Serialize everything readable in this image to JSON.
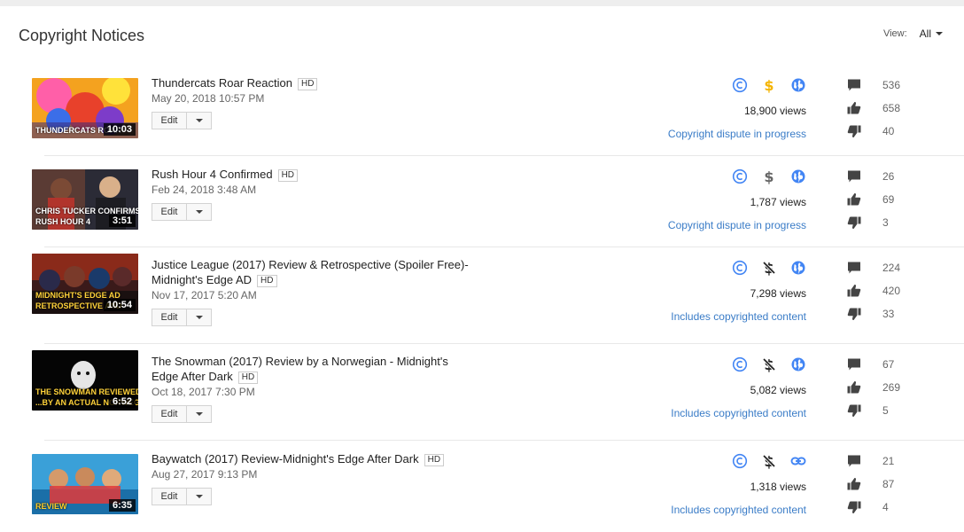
{
  "header": {
    "title": "Copyright Notices",
    "view_label": "View:",
    "view_value": "All"
  },
  "icons": {
    "copyright": "copyright-icon",
    "monetized": "dollar-icon",
    "demonetized": "dollar-off-icon",
    "public": "globe-icon",
    "unlisted": "link-icon",
    "comments": "comment-icon",
    "likes": "thumbs-up-icon",
    "dislikes": "thumbs-down-icon"
  },
  "colors": {
    "accent_blue": "#4285f4",
    "monetized_gold": "#f4b400",
    "link_blue": "#3a7cc7"
  },
  "edit_label": "Edit",
  "videos": [
    {
      "title_line1": "Thundercats Roar Reaction",
      "title_line2": "",
      "hd": "HD",
      "date": "May 20, 2018 10:57 PM",
      "duration": "10:03",
      "thumb_caption1": "",
      "thumb_caption2": "THUNDERCATS ROAR",
      "monetization": "monetized",
      "visibility": "public",
      "views": "18,900 views",
      "notice": "Copyright dispute in progress",
      "comments": "536",
      "likes": "658",
      "dislikes": "40"
    },
    {
      "title_line1": "Rush Hour 4 Confirmed",
      "title_line2": "",
      "hd": "HD",
      "date": "Feb 24, 2018 3:48 AM",
      "duration": "3:51",
      "thumb_caption1": "CHRIS TUCKER CONFIRMS",
      "thumb_caption2": "RUSH HOUR 4",
      "monetization": "monetized-gray",
      "visibility": "public",
      "views": "1,787 views",
      "notice": "Copyright dispute in progress",
      "comments": "26",
      "likes": "69",
      "dislikes": "3"
    },
    {
      "title_line1": "Justice League (2017) Review & Retrospective (Spoiler Free)-",
      "title_line2": "Midnight's Edge AD",
      "hd": "HD",
      "date": "Nov 17, 2017 5:20 AM",
      "duration": "10:54",
      "thumb_caption1": "MIDNIGHT'S EDGE AD",
      "thumb_caption2": "RETROSPECTIVE AND",
      "monetization": "demonetized",
      "visibility": "public",
      "views": "7,298 views",
      "notice": "Includes copyrighted content",
      "comments": "224",
      "likes": "420",
      "dislikes": "33"
    },
    {
      "title_line1": "The Snowman (2017) Review by a Norwegian - Midnight's",
      "title_line2": "Edge After Dark",
      "hd": "HD",
      "date": "Oct 18, 2017 7:30 PM",
      "duration": "6:52",
      "thumb_caption1": "THE SNOWMAN REVIEWED",
      "thumb_caption2": "...BY AN ACTUAL NORWEGIAN",
      "monetization": "demonetized",
      "visibility": "public",
      "views": "5,082 views",
      "notice": "Includes copyrighted content",
      "comments": "67",
      "likes": "269",
      "dislikes": "5"
    },
    {
      "title_line1": "Baywatch (2017) Review-Midnight's Edge After Dark",
      "title_line2": "",
      "hd": "HD",
      "date": "Aug 27, 2017 9:13 PM",
      "duration": "6:35",
      "thumb_caption1": "",
      "thumb_caption2": "REVIEW",
      "monetization": "demonetized",
      "visibility": "unlisted",
      "views": "1,318 views",
      "notice": "Includes copyrighted content",
      "comments": "21",
      "likes": "87",
      "dislikes": "4"
    }
  ]
}
